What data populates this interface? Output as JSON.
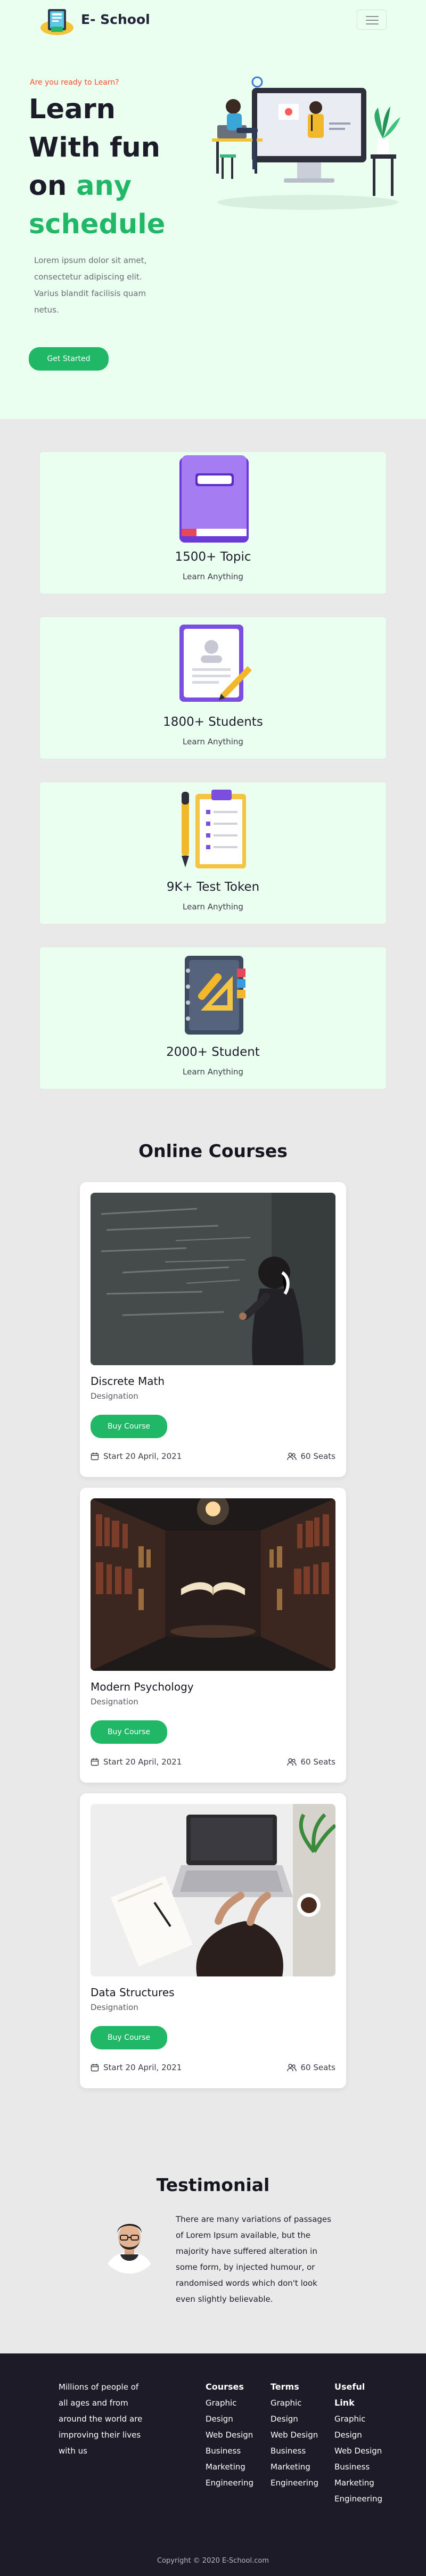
{
  "nav": {
    "brand": "E- School"
  },
  "hero": {
    "eyebrow": "Are you ready to Learn?",
    "headline_line1": "Learn",
    "headline_line2": "With fun",
    "headline_line3_prefix": "on ",
    "headline_line3_accent": "any",
    "headline_line4": "schedule",
    "description": "Lorem ipsum dolor sit amet, consectetur adipiscing elit. Varius blandit facilisis quam netus.",
    "cta_label": "Get Started"
  },
  "stats": [
    {
      "icon": "book-icon",
      "title": "1500+ Topic",
      "subtitle": "Learn Anything"
    },
    {
      "icon": "certificate-icon",
      "title": "1800+ Students",
      "subtitle": "Learn Anything"
    },
    {
      "icon": "clipboard-pencil-icon",
      "title": "9K+ Test Token",
      "subtitle": "Learn Anything"
    },
    {
      "icon": "notebook-ruler-icon",
      "title": "2000+ Student",
      "subtitle": "Learn Anything"
    }
  ],
  "courses": {
    "section_title": "Online Courses",
    "items": [
      {
        "image": "chalkboard-photo",
        "name": "Discrete Math",
        "designation": "Designation",
        "buy_label": "Buy Course",
        "start": "Start 20 April, 2021",
        "seats": "60 Seats"
      },
      {
        "image": "library-book-photo",
        "name": "Modern Psychology",
        "designation": "Designation",
        "buy_label": "Buy Course",
        "start": "Start 20 April, 2021",
        "seats": "60 Seats"
      },
      {
        "image": "laptop-desk-photo",
        "name": "Data Structures",
        "designation": "Designation",
        "buy_label": "Buy Course",
        "start": "Start 20 April, 2021",
        "seats": "60 Seats"
      }
    ]
  },
  "testimonial": {
    "section_title": "Testimonial",
    "quote": "There are many variations of passages of Lorem Ipsum available, but the majority have suffered alteration in some form, by injected humour, or randomised words which don't look even slightly believable."
  },
  "footer": {
    "about": "Millions of people of all ages and from around the world are improving their lives with us",
    "columns": [
      {
        "heading": "Courses",
        "links": [
          "Graphic Design",
          "Web Design",
          "Business",
          "Marketing",
          "Engineering"
        ]
      },
      {
        "heading": "Terms",
        "links": [
          "Graphic Design",
          "Web Design",
          "Business",
          "Marketing",
          "Engineering"
        ]
      },
      {
        "heading": "Useful Link",
        "links": [
          "Graphic Design",
          "Web Design",
          "Business",
          "Marketing",
          "Engineering"
        ]
      }
    ],
    "copyright": "Copyright © 2020 E-School.com"
  },
  "colors": {
    "accent": "#20b767",
    "eyebrow": "#ff4b2b",
    "hero_bg": "#eafff0",
    "footer_bg": "#1c1b27"
  }
}
